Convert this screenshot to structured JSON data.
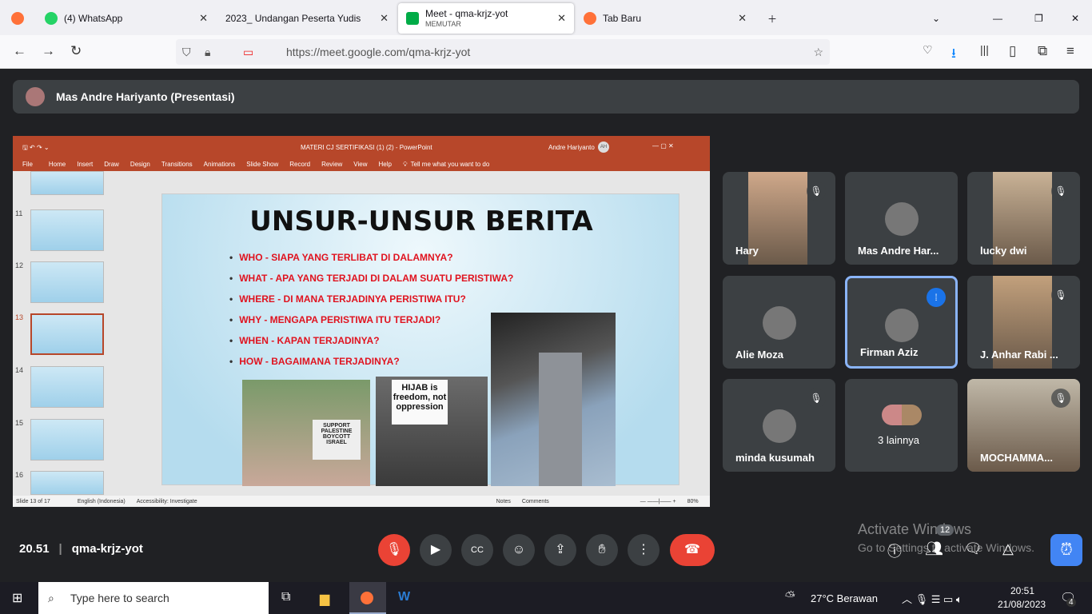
{
  "browser": {
    "tabs": [
      {
        "label": "(4) WhatsApp"
      },
      {
        "label": "2023_ Undangan Peserta Yudisium"
      },
      {
        "label": "Meet - qma-krjz-yot",
        "sub": "MEMUTAR"
      },
      {
        "label": "Tab Baru"
      }
    ],
    "url": "https://meet.google.com/qma-krjz-yot"
  },
  "presenter": {
    "label": "Mas Andre Hariyanto (Presentasi)"
  },
  "ppt": {
    "title": "MATERI CJ SERTIFIKASI (1) (2) - PowerPoint",
    "user": "Andre Hariyanto",
    "user_initials": "AH",
    "ribbon": [
      "File",
      "Home",
      "Insert",
      "Draw",
      "Design",
      "Transitions",
      "Animations",
      "Slide Show",
      "Record",
      "Review",
      "View",
      "Help",
      "Tell me what you want to do"
    ],
    "thumbs": [
      "11",
      "12",
      "13",
      "14",
      "15",
      "16"
    ],
    "slide": {
      "title": "UNSUR-UNSUR BERITA",
      "bullets": [
        "WHO - SIAPA YANG TERLIBAT DI DALAMNYA?",
        "WHAT - APA YANG TERJADI DI DALAM SUATU PERISTIWA?",
        "WHERE - DI MANA TERJADINYA PERISTIWA ITU?",
        "WHY - MENGAPA PERISTIWA ITU TERJADI?",
        "WHEN - KAPAN TERJADINYA?",
        "HOW - BAGAIMANA TERJADINYA?"
      ],
      "sign1": "SUPPORT PALESTINE BOYCOTT ISRAEL",
      "sign2": "HIJAB is freedom, not oppression"
    },
    "status": {
      "slide": "Slide 13 of 17",
      "lang": "English (Indonesia)",
      "access": "Accessibility: Investigate",
      "notes": "Notes",
      "comments": "Comments",
      "zoom": "80%"
    }
  },
  "participants": [
    {
      "name": "Hary",
      "muted": true
    },
    {
      "name": "Mas Andre Har...",
      "muted": false
    },
    {
      "name": "lucky dwi",
      "muted": true
    },
    {
      "name": "Alie Moza",
      "muted": false
    },
    {
      "name": "Firman Aziz",
      "speaking": true
    },
    {
      "name": "J. Anhar Rabi ...",
      "muted": true
    },
    {
      "name": "minda kusumah",
      "muted": true
    },
    {
      "name": "3 lainnya"
    },
    {
      "name": "MOCHAMMA...",
      "muted": true
    }
  ],
  "meeting": {
    "time": "20.51",
    "code": "qma-krjz-yot",
    "people_count": "12"
  },
  "watermark": {
    "line1": "Activate Windows",
    "line2": "Go to Settings to activate Windows."
  },
  "taskbar": {
    "search": "Type here to search",
    "weather": "27°C  Berawan",
    "time": "20:51",
    "date": "21/08/2023",
    "notif": "4"
  },
  "colors": {
    "accent": "#8ab4f8",
    "end_call": "#ea4335",
    "ppt": "#b7472a"
  }
}
